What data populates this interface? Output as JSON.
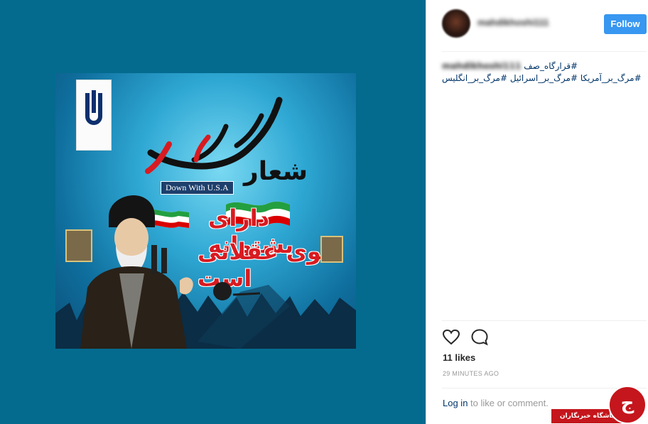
{
  "post": {
    "username": "mahdikhoshi111",
    "follow_label": "Follow",
    "caption": {
      "user": "mahdikhoshi111",
      "line1": "#قرارگاه_صف",
      "line2": "#مرگ_بر_آمریکا #مرگ_بر_اسرائیل #مرگ_بر_انگلیس"
    },
    "likes": "11 likes",
    "time": "29 MINUTES AGO",
    "login_link": "Log in",
    "login_rest": " to like or comment."
  },
  "poster": {
    "slogan_word": "شعار",
    "calligraphy": "مرگ بر آمریکا",
    "english_band": "Down With U.S.A",
    "red_line1": "دارای پشتوانه",
    "red_line2": "قوی عقلانی است"
  },
  "watermark": {
    "label": "باشگاه خبرنگاران"
  },
  "colors": {
    "media_bg": "#046b8f",
    "follow_btn": "#3897f0",
    "link": "#003569",
    "muted": "#999999",
    "watermark_red": "#c4161c"
  },
  "icons": [
    "heart-icon",
    "comment-icon"
  ]
}
